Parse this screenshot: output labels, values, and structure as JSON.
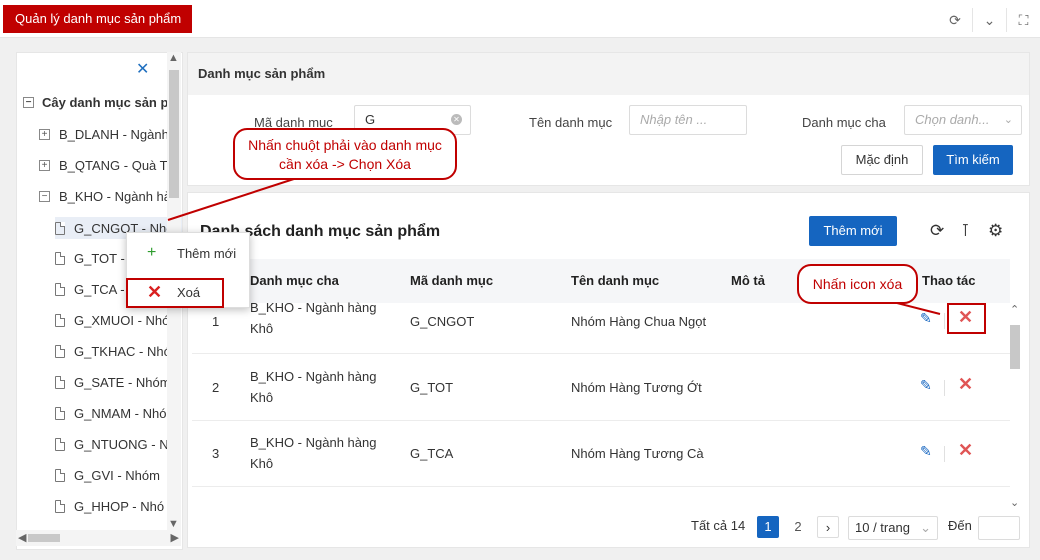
{
  "window": {
    "tab_title": "Quản lý danh mục sản phẩm"
  },
  "tree": {
    "root_label": "Cây danh mục sản p",
    "nodes": [
      {
        "label": "B_DLANH - Ngành",
        "type": "group",
        "expanded": false
      },
      {
        "label": "B_QTANG - Quà Tả",
        "type": "group",
        "expanded": false
      },
      {
        "label": "B_KHO - Ngành hà",
        "type": "group",
        "expanded": true
      },
      {
        "label": "G_CNGOT - Nhó",
        "type": "leaf"
      },
      {
        "label": "G_TOT - Nh",
        "type": "leaf"
      },
      {
        "label": "G_TCA - N",
        "type": "leaf"
      },
      {
        "label": "G_XMUOI - Nhó",
        "type": "leaf"
      },
      {
        "label": "G_TKHAC - Nhó",
        "type": "leaf"
      },
      {
        "label": "G_SATE - Nhóm",
        "type": "leaf"
      },
      {
        "label": "G_NMAM - Nhó",
        "type": "leaf"
      },
      {
        "label": "G_NTUONG - N",
        "type": "leaf"
      },
      {
        "label": "G_GVI - Nhóm",
        "type": "leaf"
      },
      {
        "label": "G_HHOP - Nhó",
        "type": "leaf"
      }
    ]
  },
  "context_menu": {
    "add_label": "Thêm mới",
    "delete_label": "Xoá"
  },
  "filter": {
    "title": "Danh mục sản phẩm",
    "code_label": "Mã danh mục",
    "code_value": "G",
    "name_label": "Tên danh mục",
    "name_placeholder": "Nhập tên ...",
    "parent_label": "Danh mục cha",
    "parent_placeholder": "Chọn danh...",
    "reset_label": "Mặc định",
    "search_label": "Tìm kiếm"
  },
  "list": {
    "title": "Danh sách danh mục sản phẩm",
    "add_label": "Thêm mới",
    "columns": [
      "Danh mục cha",
      "Mã danh mục",
      "Tên danh mục",
      "Mô tả",
      "Thao tác"
    ],
    "rows": [
      {
        "index": "1",
        "parent": "B_KHO - Ngành hàng Khô",
        "code": "G_CNGOT",
        "name": "Nhóm Hàng Chua Ngọt",
        "desc": ""
      },
      {
        "index": "2",
        "parent": "B_KHO - Ngành hàng Khô",
        "code": "G_TOT",
        "name": "Nhóm Hàng Tương Ớt",
        "desc": ""
      },
      {
        "index": "3",
        "parent": "B_KHO - Ngành hàng Khô",
        "code": "G_TCA",
        "name": "Nhóm Hàng Tương Cà",
        "desc": ""
      }
    ]
  },
  "pagination": {
    "total": "Tất cả 14",
    "pages": [
      "1",
      "2"
    ],
    "current": "1",
    "per_page": "10 / trang",
    "goto_label": "Đến"
  },
  "annotations": {
    "right_click": "Nhấn chuột phải vào danh mục cần xóa -> Chọn Xóa",
    "click_icon": "Nhấn icon xóa"
  },
  "colors": {
    "brand_red": "#c00000",
    "primary_blue": "#1565c0",
    "delete_red": "#e05555",
    "add_green": "#2e9d2e"
  }
}
